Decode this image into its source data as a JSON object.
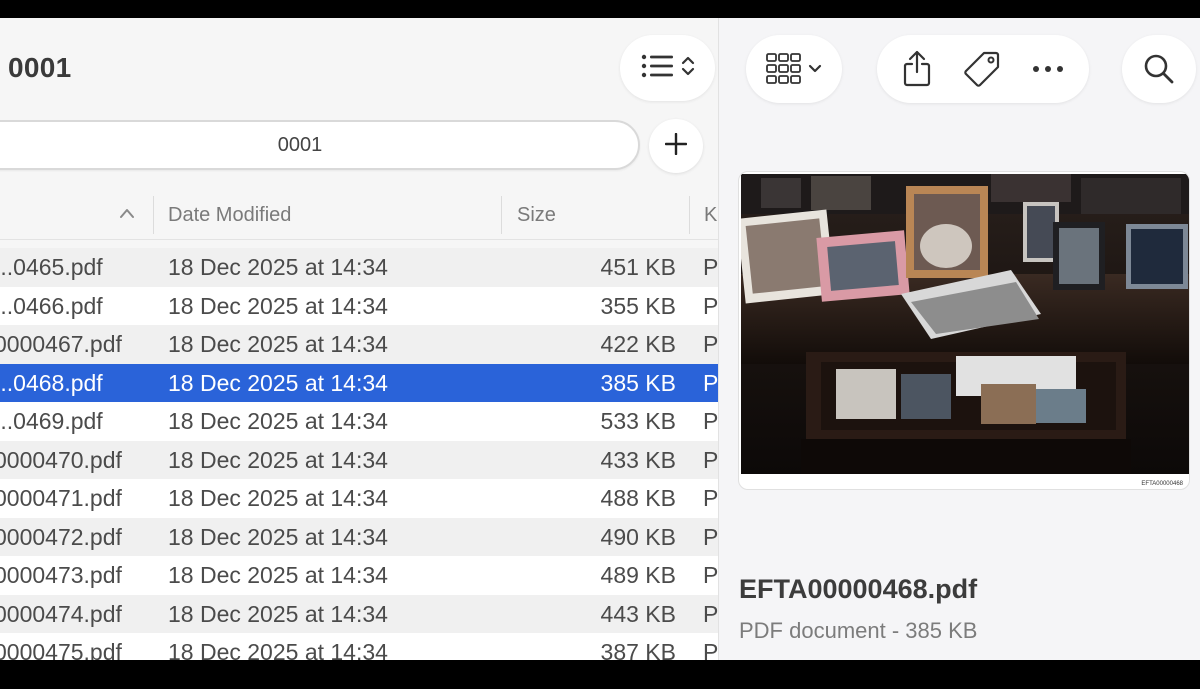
{
  "finder": {
    "window_title": "0001",
    "path_field": "0001",
    "columns": {
      "date": "Date Modified",
      "size": "Size",
      "kind": "K"
    },
    "rows": [
      {
        "name": "...0465.pdf",
        "date": "18 Dec 2025 at 14:34",
        "size": "451 KB",
        "kind": "P"
      },
      {
        "name": "...0466.pdf",
        "date": "18 Dec 2025 at 14:34",
        "size": "355 KB",
        "kind": "P"
      },
      {
        "name": "0000467.pdf",
        "date": "18 Dec 2025 at 14:34",
        "size": "422 KB",
        "kind": "P"
      },
      {
        "name": "...0468.pdf",
        "date": "18 Dec 2025 at 14:34",
        "size": "385 KB",
        "kind": "P"
      },
      {
        "name": "...0469.pdf",
        "date": "18 Dec 2025 at 14:34",
        "size": "533 KB",
        "kind": "P"
      },
      {
        "name": "0000470.pdf",
        "date": "18 Dec 2025 at 14:34",
        "size": "433 KB",
        "kind": "P"
      },
      {
        "name": "0000471.pdf",
        "date": "18 Dec 2025 at 14:34",
        "size": "488 KB",
        "kind": "P"
      },
      {
        "name": "0000472.pdf",
        "date": "18 Dec 2025 at 14:34",
        "size": "490 KB",
        "kind": "P"
      },
      {
        "name": "0000473.pdf",
        "date": "18 Dec 2025 at 14:34",
        "size": "489 KB",
        "kind": "P"
      },
      {
        "name": "0000474.pdf",
        "date": "18 Dec 2025 at 14:34",
        "size": "443 KB",
        "kind": "P"
      },
      {
        "name": "0000475.pdf",
        "date": "18 Dec 2025 at 14:34",
        "size": "387 KB",
        "kind": "P"
      }
    ],
    "selected_row_index": 3
  },
  "toolbar": {
    "icons": [
      "list-view-icon",
      "gallery-view-icon",
      "share-icon",
      "tag-icon",
      "more-icon",
      "search-icon",
      "add-icon"
    ]
  },
  "preview": {
    "image_caption": "EFTA00000468",
    "file_name": "EFTA00000468.pdf",
    "file_info": "PDF document - 385 KB"
  },
  "colors": {
    "selection": "#2a63d9",
    "pane_background": "#f5f5f7"
  }
}
